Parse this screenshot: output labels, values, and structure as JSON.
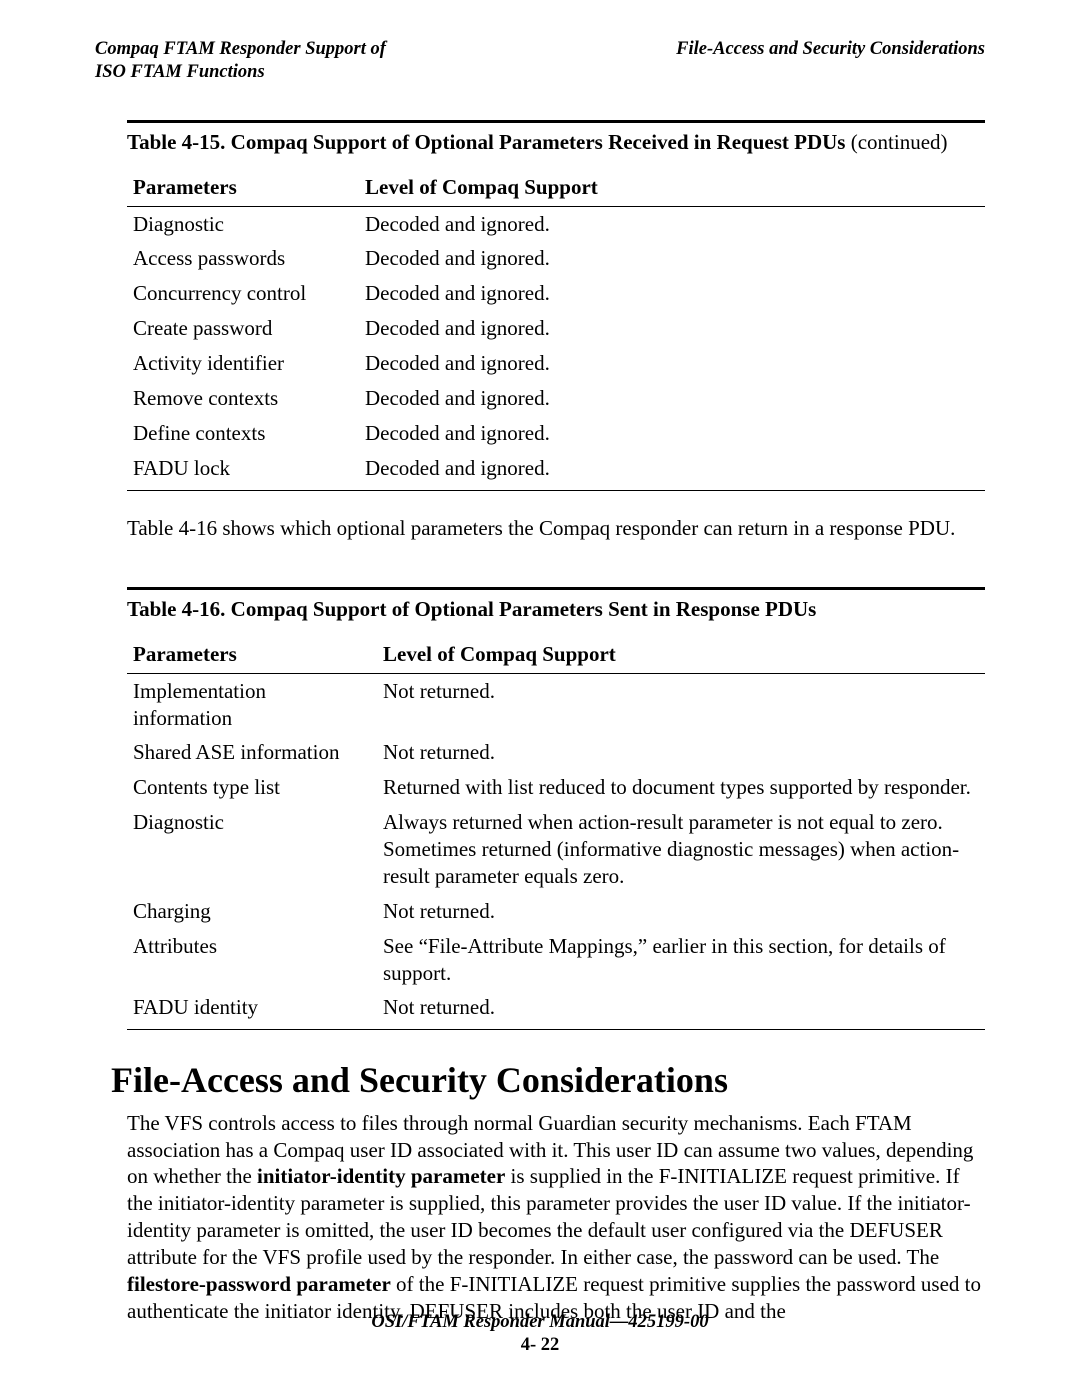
{
  "header": {
    "left_line1": "Compaq FTAM Responder Support of",
    "left_line2": "ISO FTAM Functions",
    "right": "File-Access and Security Considerations"
  },
  "table15": {
    "caption_prefix": "Table 4-15.  Compaq Support of Optional Parameters Received in Request PDUs",
    "caption_suffix": "  (continued)",
    "col1": "Parameters",
    "col2": "Level of Compaq Support",
    "rows": [
      {
        "p": "Diagnostic",
        "s": "Decoded and ignored."
      },
      {
        "p": "Access passwords",
        "s": "Decoded and ignored."
      },
      {
        "p": "Concurrency control",
        "s": "Decoded and ignored."
      },
      {
        "p": "Create password",
        "s": "Decoded and ignored."
      },
      {
        "p": "Activity identifier",
        "s": "Decoded and ignored."
      },
      {
        "p": "Remove contexts",
        "s": "Decoded and ignored."
      },
      {
        "p": "Define contexts",
        "s": "Decoded and ignored."
      },
      {
        "p": "FADU lock",
        "s": "Decoded and ignored."
      }
    ]
  },
  "middle_para": "Table 4-16 shows which optional parameters the Compaq responder can return in a response PDU.",
  "table16": {
    "caption": "Table 4-16.  Compaq Support of Optional Parameters Sent in Response PDUs",
    "col1": "Parameters",
    "col2": "Level of Compaq Support",
    "rows": [
      {
        "p": "Implementation information",
        "s": "Not returned."
      },
      {
        "p": "Shared ASE information",
        "s": "Not returned."
      },
      {
        "p": "Contents type list",
        "s": "Returned with list reduced to document types supported by responder."
      },
      {
        "p": "Diagnostic",
        "s": "Always returned when action-result parameter is not equal to zero.  Sometimes returned (informative diagnostic messages) when action-result parameter equals zero."
      },
      {
        "p": "Charging",
        "s": "Not returned."
      },
      {
        "p": "Attributes",
        "s": "See “File-Attribute Mappings,” earlier in this section, for details of support."
      },
      {
        "p": "FADU identity",
        "s": "Not returned."
      }
    ]
  },
  "section_heading": "File-Access and Security Considerations",
  "body": {
    "pre1": "The VFS controls access to files through normal Guardian security mechanisms.  Each FTAM association has a Compaq user ID associated with it.  This user ID can assume two values, depending on whether the ",
    "bold1": "initiator-identity parameter",
    "mid1": " is supplied in the F-INITIALIZE request primitive.  If the initiator-identity parameter is supplied, this parameter provides the user ID value.  If the initiator-identity parameter is omitted, the user ID becomes the default user configured via the DEFUSER attribute for the VFS profile used by the responder.  In either case, the password can be used.  The ",
    "bold2": "filestore-password parameter",
    "post1": " of the F-INITIALIZE request primitive supplies the password used to authenticate the initiator identity.  DEFUSER includes both the user ID and the"
  },
  "footer": {
    "manual": "OSI/FTAM Responder Manual",
    "docnum": "—425199-00",
    "docnum_visible": "425199-00",
    "pagenum": "4- 22"
  }
}
